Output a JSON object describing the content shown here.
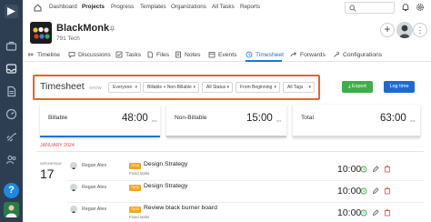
{
  "colors": {
    "sidebar": "#2e3e52",
    "accent_blue": "#1976d2",
    "highlight_border": "#e8632b",
    "export_green": "#3fae49",
    "logtime_blue": "#1e6ad0",
    "date_red": "#e0504e",
    "tag_orange": "#f5a623"
  },
  "topnav": {
    "items": [
      {
        "label": "Dashboard",
        "active": false
      },
      {
        "label": "Projects",
        "active": true
      },
      {
        "label": "Progress",
        "active": false
      },
      {
        "label": "Templates",
        "active": false
      },
      {
        "label": "Organizations",
        "active": false
      },
      {
        "label": "All Tasks",
        "active": false
      },
      {
        "label": "Reports",
        "active": false
      }
    ]
  },
  "project": {
    "name": "BlackMonk",
    "subtitle": "791 Tech"
  },
  "tabs": [
    {
      "label": "Timeline",
      "icon": "timeline-icon"
    },
    {
      "label": "Discussions",
      "icon": "discussions-icon"
    },
    {
      "label": "Tasks",
      "icon": "tasks-icon"
    },
    {
      "label": "Files",
      "icon": "files-icon"
    },
    {
      "label": "Notes",
      "icon": "notes-icon"
    },
    {
      "label": "Events",
      "icon": "events-icon"
    },
    {
      "label": "Timesheet",
      "icon": "timesheet-icon",
      "active": true
    },
    {
      "label": "Forwards",
      "icon": "forwards-icon"
    },
    {
      "label": "Configurations",
      "icon": "configurations-icon"
    }
  ],
  "toolbar": {
    "title": "Timesheet",
    "show_label": "SHOW",
    "filters": {
      "people": "Everyone",
      "billing": "Billable + Non-Billable",
      "status": "All Status",
      "period": "From Beginning",
      "tags": "All Tags"
    },
    "export_label": "Export",
    "logtime_label": "Log time"
  },
  "summary": {
    "billable": {
      "label": "Billable",
      "value": "48:00",
      "unit": "hrs"
    },
    "non_billable": {
      "label": "Non-Billable",
      "value": "15:00",
      "unit": "hrs"
    },
    "total": {
      "label": "Total",
      "value": "63:00",
      "unit": "hrs"
    }
  },
  "date_group": {
    "header": "JANUARY 2024",
    "weekday": "WEDNESDAY",
    "day": "17"
  },
  "entries": [
    {
      "user": "Regan Alex",
      "tag": "TASK",
      "task": "Design Strategy",
      "list": "Fixed tasks",
      "time": "10:00"
    },
    {
      "user": "Regan Alex",
      "tag": "TASK",
      "task": "Design Strategy",
      "list": "",
      "time": "10:00"
    },
    {
      "user": "Regan Alex",
      "tag": "TASK",
      "task": "Review black burner board",
      "list": "Fixed tasks",
      "time": "10:00"
    }
  ]
}
